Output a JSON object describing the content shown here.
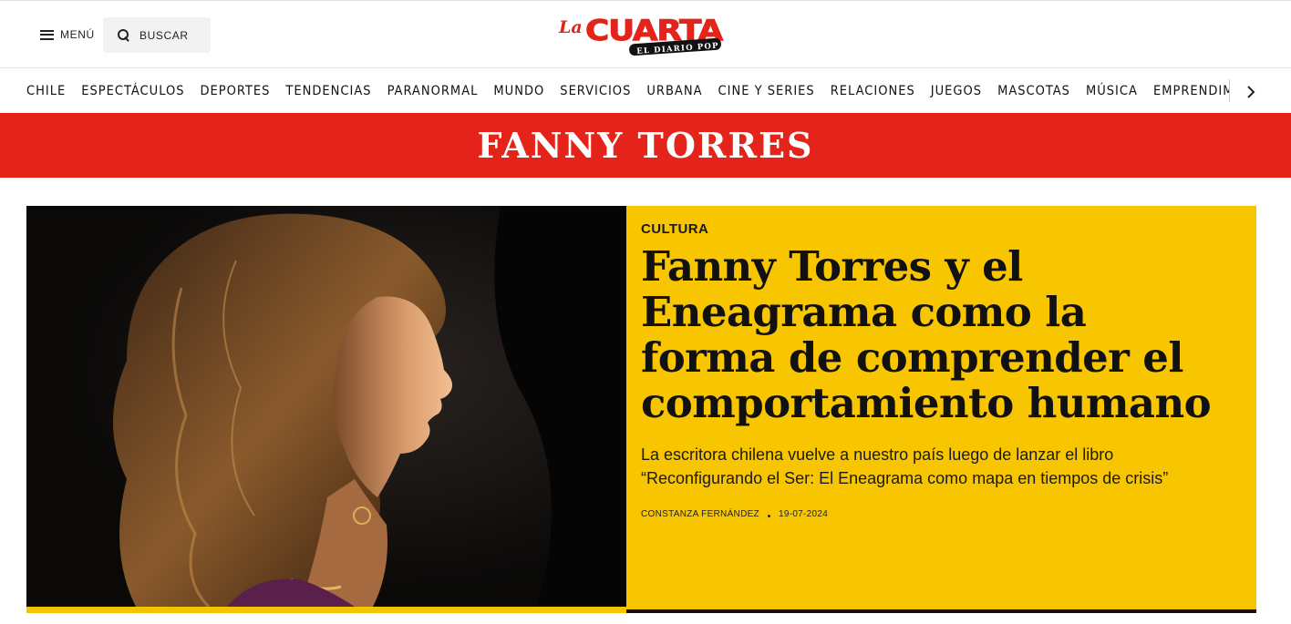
{
  "header": {
    "menu_label": "MENÚ",
    "search_label": "BUSCAR",
    "logo": {
      "prefix": "La",
      "name": "CUARTA",
      "tagline": "EL DIARIO POP",
      "brand_color": "#e4241b"
    }
  },
  "sections": [
    "CHILE",
    "ESPECTÁCULOS",
    "DEPORTES",
    "TENDENCIAS",
    "PARANORMAL",
    "MUNDO",
    "SERVICIOS",
    "URBANA",
    "CINE Y SERIES",
    "RELACIONES",
    "JUEGOS",
    "MASCOTAS",
    "MÚSICA",
    "EMPRENDIMIE"
  ],
  "tag_banner": {
    "title": "FANNY TORRES",
    "color": "#e4241b"
  },
  "featured": {
    "kicker": "CULTURA",
    "headline": "Fanny Torres y el Eneagrama como la forma de comprender el comportamiento humano",
    "subtitle": "La escritora chilena vuelve a nuestro país luego de lanzar el libro “Reconfigurando el Ser: El Eneagrama como mapa en tiempos de crisis”",
    "author": "CONSTANZA FERNÁNDEZ",
    "date": "19-07-2024",
    "card_color": "#f8c600"
  },
  "icons": {
    "menu": "menu-icon",
    "search": "search-icon",
    "nav_next": "chevron-right-icon"
  }
}
